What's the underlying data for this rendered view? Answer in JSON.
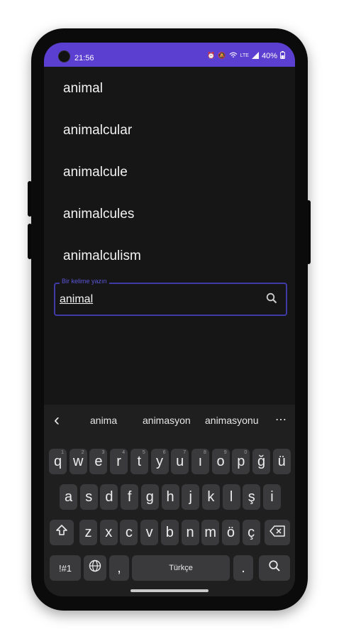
{
  "status_bar": {
    "time": "21:56",
    "battery": "40%",
    "icons": [
      "alarm-icon",
      "silent-icon",
      "wifi-icon",
      "lte-icon",
      "signal-icon",
      "battery-icon"
    ],
    "accent": "#5a3fd0"
  },
  "suggestions": [
    "animal",
    "animalcular",
    "animalcule",
    "animalcules",
    "animalculism"
  ],
  "search": {
    "label": "Bir kelime yazın",
    "value": "animal",
    "icon": "search-icon",
    "border_color": "#3f3aa6"
  },
  "keyboard": {
    "predictions": [
      "anima",
      "animasyon",
      "animasyonu"
    ],
    "more": "⋯",
    "back": "‹",
    "row1": [
      "q",
      "w",
      "e",
      "r",
      "t",
      "y",
      "u",
      "ı",
      "o",
      "p",
      "ğ",
      "ü"
    ],
    "row1_hints": [
      "1",
      "2",
      "3",
      "4",
      "5",
      "6",
      "7",
      "8",
      "9",
      "0",
      "",
      ""
    ],
    "row2": [
      "a",
      "s",
      "d",
      "f",
      "g",
      "h",
      "j",
      "k",
      "l",
      "ş",
      "i"
    ],
    "row3": [
      "z",
      "x",
      "c",
      "v",
      "b",
      "n",
      "m",
      "ö",
      "ç"
    ],
    "symbols_label": "!#1",
    "comma": ",",
    "period": ".",
    "space_label": "Türkçe",
    "shift_icon": "shift-icon",
    "backspace_icon": "backspace-icon",
    "globe_icon": "globe-icon",
    "enter_icon": "search-icon"
  }
}
